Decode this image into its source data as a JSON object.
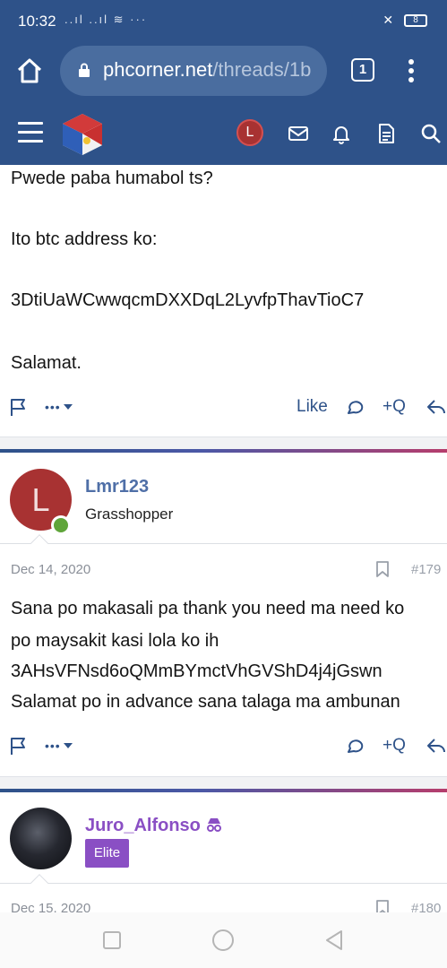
{
  "status_bar": {
    "time": "10:32",
    "signal": "..ıl ..ıl  ≋  ···",
    "battery": "8"
  },
  "browser": {
    "url_host": "phcorner.net",
    "url_path": "/threads/1b",
    "tab_count": "1"
  },
  "site_nav": {
    "user_initial": "L"
  },
  "post_prev": {
    "lines": [
      "Pwede paba humabol ts?",
      "Ito btc address ko:",
      "3DtiUaWCwwqcmDXXDqL2LyvfpThavTioC7",
      "Salamat."
    ],
    "actions": {
      "more": "•••",
      "like": "Like",
      "quote": "+Q"
    }
  },
  "post_179": {
    "username": "Lmr123",
    "avatar_initial": "L",
    "user_title": "Grasshopper",
    "date": "Dec 14, 2020",
    "post_number": "#179",
    "lines": [
      "Sana po makasali pa thank you need ma need ko",
      "po maysakit kasi lola ko ih",
      "3AHsVFNsd6oQMmBYmctVhGVShD4j4jGswn",
      "Salamat po in advance sana talaga ma ambunan"
    ],
    "actions": {
      "more": "•••",
      "quote": "+Q"
    }
  },
  "post_180": {
    "username": "Juro_Alfonso",
    "user_title": "Elite",
    "date": "Dec 15, 2020",
    "post_number": "#180"
  },
  "colors": {
    "nav": "#2e5289",
    "link": "#2e5289",
    "username_blue": "#4f6fa7",
    "username_purple": "#8a4fc4",
    "avatar_red": "#a83232",
    "online": "#5fa53a"
  }
}
